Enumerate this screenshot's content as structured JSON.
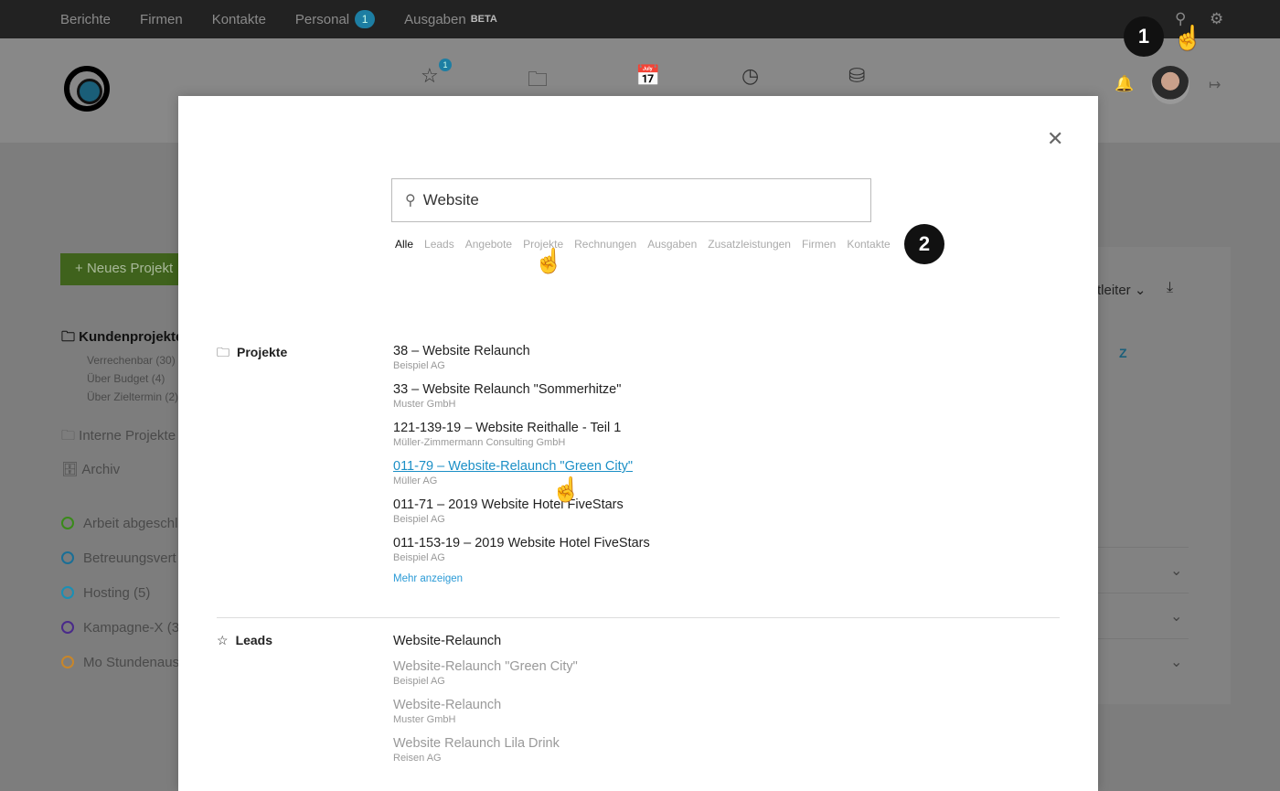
{
  "topnav": {
    "items": [
      {
        "label": "Berichte"
      },
      {
        "label": "Firmen"
      },
      {
        "label": "Kontakte"
      },
      {
        "label": "Personal",
        "badge": "1"
      },
      {
        "label": "Ausgaben",
        "tag": "BETA"
      }
    ]
  },
  "header": {
    "favorites_badge": "1"
  },
  "sidebar": {
    "new_button": "Neues Projekt",
    "kunden": "Kundenprojekte",
    "sub": [
      "Verrechenbar (30)",
      "Über Budget (4)",
      "Über Zieltermin (2)"
    ],
    "intern": "Interne Projekte",
    "archiv": "Archiv",
    "tags": [
      {
        "label": "Arbeit abgeschl",
        "color": "#3a8a1a"
      },
      {
        "label": "Betreuungsvert",
        "color": "#1a6f96"
      },
      {
        "label": "Hosting (5)",
        "color": "#1a8fb5"
      },
      {
        "label": "Kampagne-X (3",
        "color": "#4a2a8a"
      },
      {
        "label": "Mo Stundenaus",
        "color": "#c8862a"
      }
    ]
  },
  "rightpanel": {
    "dropdown": "tleiter",
    "letter": "Z"
  },
  "search": {
    "value": "Website",
    "filters": [
      "Alle",
      "Leads",
      "Angebote",
      "Projekte",
      "Rechnungen",
      "Ausgaben",
      "Zusatzleistungen",
      "Firmen",
      "Kontakte"
    ],
    "active": "Alle"
  },
  "steps": [
    "1",
    "2"
  ],
  "projekte": {
    "label": "Projekte",
    "items": [
      {
        "title": "38 – Website Relaunch",
        "sub": "Beispiel AG"
      },
      {
        "title": "33 – Website Relaunch \"Sommerhitze\"",
        "sub": "Muster GmbH"
      },
      {
        "title": "121-139-19 – Website Reithalle - Teil 1",
        "sub": "Müller-Zimmermann Consulting GmbH"
      },
      {
        "title": "011-79 – Website-Relaunch \"Green City\"",
        "sub": "Müller AG"
      },
      {
        "title": "011-71 – 2019 Website Hotel FiveStars",
        "sub": "Beispiel AG"
      },
      {
        "title": "011-153-19 – 2019 Website Hotel FiveStars",
        "sub": "Beispiel AG"
      }
    ],
    "more": "Mehr anzeigen"
  },
  "leads": {
    "label": "Leads",
    "items": [
      {
        "title": "Website-Relaunch",
        "sub": ""
      },
      {
        "title": "Website-Relaunch \"Green City\"",
        "sub": "Beispiel AG"
      },
      {
        "title": "Website-Relaunch",
        "sub": "Muster GmbH"
      },
      {
        "title": "Website Relaunch Lila Drink",
        "sub": "Reisen AG"
      }
    ]
  },
  "colors": {
    "accent": "#1b8fc6",
    "badge": "#1d7ea3",
    "green": "#3f621c"
  }
}
